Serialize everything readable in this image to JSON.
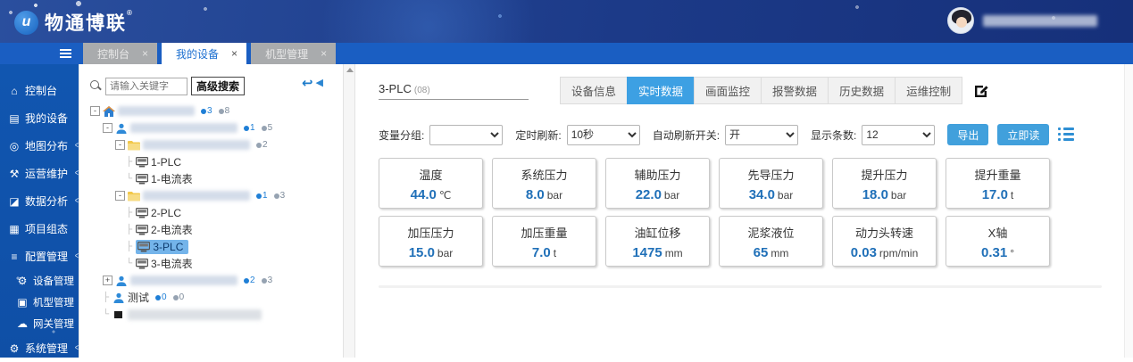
{
  "colors": {
    "accent_blue": "#3da0e3",
    "sidebar_blue": "#1156b0",
    "topbar_navy": "#1c3a88",
    "value_blue": "#2070b8",
    "selected_node_bg": "#74b4ea"
  },
  "icons": {
    "close": "×",
    "chevron": "<",
    "back": "↩",
    "collapse": "◀",
    "logo_glyph": "u",
    "registered": "®",
    "sidebar": [
      "⌂",
      "▤",
      "◎",
      "⚒",
      "◪",
      "▦",
      "≡",
      "⚙",
      "▣",
      "☁",
      "⚙"
    ]
  },
  "brand": {
    "logo_text": "物通博联"
  },
  "window_tabs": {
    "items": [
      {
        "label": "控制台"
      },
      {
        "label": "我的设备"
      },
      {
        "label": "机型管理"
      }
    ]
  },
  "sidebar": {
    "items": [
      {
        "label": "控制台"
      },
      {
        "label": "我的设备"
      },
      {
        "label": "地图分布",
        "chevron": "<"
      },
      {
        "label": "运营维护",
        "chevron": "<"
      },
      {
        "label": "数据分析",
        "chevron": "<"
      },
      {
        "label": "项目组态"
      },
      {
        "label": "配置管理",
        "chevron": "<"
      },
      {
        "label": "设备管理"
      },
      {
        "label": "机型管理"
      },
      {
        "label": "网关管理"
      },
      {
        "label": "系统管理",
        "chevron": "<"
      }
    ]
  },
  "tree": {
    "search_placeholder": "请输入关键字",
    "advanced_search_label": "高级搜索",
    "expand_minus": "-",
    "expand_plus": "+",
    "nodes": {
      "root": {
        "badge1": "3",
        "badge2": "8"
      },
      "group1": {
        "badge1": "1",
        "badge2": "5"
      },
      "folder1": {
        "badge2": "2"
      },
      "dev1a": {
        "label": "1-PLC"
      },
      "dev1b": {
        "label": "1-电流表"
      },
      "folder2": {
        "badge1": "1",
        "badge2": "3"
      },
      "dev2a": {
        "label": "2-PLC"
      },
      "dev2b": {
        "label": "2-电流表"
      },
      "dev3a": {
        "label": "3-PLC"
      },
      "dev3b": {
        "label": "3-电流表"
      },
      "group2": {
        "badge1": "2",
        "badge2": "3"
      },
      "group3": {
        "label": "测试",
        "badge1": "0",
        "badge2": "0"
      }
    }
  },
  "main": {
    "device_title": "3-PLC",
    "device_code": "(08)",
    "detail_tabs": [
      {
        "label": "设备信息"
      },
      {
        "label": "实时数据"
      },
      {
        "label": "画面监控"
      },
      {
        "label": "报警数据"
      },
      {
        "label": "历史数据"
      },
      {
        "label": "运维控制"
      }
    ],
    "filters": {
      "group_label": "变量分组:",
      "group_value": "",
      "refresh_label": "定时刷新:",
      "refresh_value": "10秒",
      "auto_label": "自动刷新开关:",
      "auto_value": "开",
      "count_label": "显示条数:",
      "count_value": "12",
      "export_label": "导出",
      "read_now_label": "立即读"
    },
    "cards": [
      {
        "name": "温度",
        "value": "44.0",
        "unit": "℃"
      },
      {
        "name": "系统压力",
        "value": "8.0",
        "unit": "bar"
      },
      {
        "name": "辅助压力",
        "value": "22.0",
        "unit": "bar"
      },
      {
        "name": "先导压力",
        "value": "34.0",
        "unit": "bar"
      },
      {
        "name": "提升压力",
        "value": "18.0",
        "unit": "bar"
      },
      {
        "name": "提升重量",
        "value": "17.0",
        "unit": "t"
      },
      {
        "name": "加压压力",
        "value": "15.0",
        "unit": "bar"
      },
      {
        "name": "加压重量",
        "value": "7.0",
        "unit": "t"
      },
      {
        "name": "油缸位移",
        "value": "1475",
        "unit": "mm"
      },
      {
        "name": "泥浆液位",
        "value": "65",
        "unit": "mm"
      },
      {
        "name": "动力头转速",
        "value": "0.03",
        "unit": "rpm/min"
      },
      {
        "name": "X轴",
        "value": "0.31",
        "unit": "°"
      }
    ]
  }
}
